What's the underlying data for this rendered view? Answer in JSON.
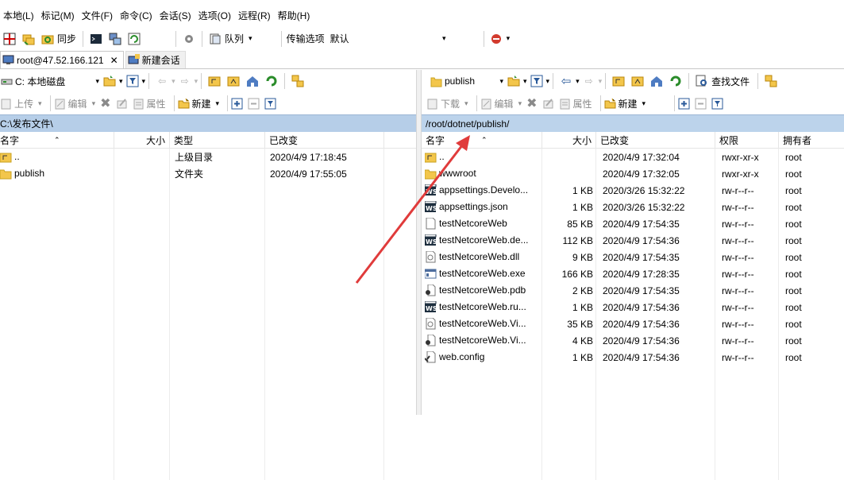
{
  "menu": [
    "本地(L)",
    "标记(M)",
    "文件(F)",
    "命令(C)",
    "会话(S)",
    "选项(O)",
    "远程(R)",
    "帮助(H)"
  ],
  "toolbar": {
    "sync_label": "同步",
    "queue_label": "队列",
    "transfer_options_label": "传输选项",
    "transfer_preset": "默认"
  },
  "tabs": {
    "session": "root@47.52.166.121",
    "new_session": "新建会话"
  },
  "local": {
    "drive": "C: 本地磁盘",
    "actions": {
      "upload": "上传",
      "edit": "编辑",
      "properties": "属性",
      "new": "新建"
    },
    "path": "C:\\发布文件\\",
    "columns": [
      "名字",
      "大小",
      "类型",
      "已改变"
    ],
    "rows": [
      {
        "name": "..",
        "size": "",
        "type": "上级目录",
        "changed": "2020/4/9  17:18:45",
        "icon": "parent-dir-icon"
      },
      {
        "name": "publish",
        "size": "",
        "type": "文件夹",
        "changed": "2020/4/9  17:55:05",
        "icon": "folder-icon"
      }
    ]
  },
  "remote": {
    "folder": "publish",
    "find_files_label": "查找文件",
    "actions": {
      "download": "下载",
      "edit": "编辑",
      "properties": "属性",
      "new": "新建"
    },
    "path": "/root/dotnet/publish/",
    "columns": [
      "名字",
      "大小",
      "已改变",
      "权限",
      "拥有者"
    ],
    "rows": [
      {
        "name": "..",
        "size": "",
        "changed": "2020/4/9 17:32:04",
        "perm": "rwxr-xr-x",
        "owner": "root",
        "icon": "parent-dir-icon"
      },
      {
        "name": "wwwroot",
        "size": "",
        "changed": "2020/4/9 17:32:05",
        "perm": "rwxr-xr-x",
        "owner": "root",
        "icon": "folder-icon"
      },
      {
        "name": "appsettings.Develo...",
        "size": "1 KB",
        "changed": "2020/3/26 15:32:22",
        "perm": "rw-r--r--",
        "owner": "root",
        "icon": "ws-file-icon"
      },
      {
        "name": "appsettings.json",
        "size": "1 KB",
        "changed": "2020/3/26 15:32:22",
        "perm": "rw-r--r--",
        "owner": "root",
        "icon": "ws-file-icon"
      },
      {
        "name": "testNetcoreWeb",
        "size": "85 KB",
        "changed": "2020/4/9 17:54:35",
        "perm": "rw-r--r--",
        "owner": "root",
        "icon": "blank-file-icon"
      },
      {
        "name": "testNetcoreWeb.de...",
        "size": "112 KB",
        "changed": "2020/4/9 17:54:36",
        "perm": "rw-r--r--",
        "owner": "root",
        "icon": "ws-file-icon"
      },
      {
        "name": "testNetcoreWeb.dll",
        "size": "9 KB",
        "changed": "2020/4/9 17:54:35",
        "perm": "rw-r--r--",
        "owner": "root",
        "icon": "dll-file-icon"
      },
      {
        "name": "testNetcoreWeb.exe",
        "size": "166 KB",
        "changed": "2020/4/9 17:28:35",
        "perm": "rw-r--r--",
        "owner": "root",
        "icon": "exe-file-icon"
      },
      {
        "name": "testNetcoreWeb.pdb",
        "size": "2 KB",
        "changed": "2020/4/9 17:54:35",
        "perm": "rw-r--r--",
        "owner": "root",
        "icon": "pdb-file-icon"
      },
      {
        "name": "testNetcoreWeb.ru...",
        "size": "1 KB",
        "changed": "2020/4/9 17:54:36",
        "perm": "rw-r--r--",
        "owner": "root",
        "icon": "ws-file-icon"
      },
      {
        "name": "testNetcoreWeb.Vi...",
        "size": "35 KB",
        "changed": "2020/4/9 17:54:36",
        "perm": "rw-r--r--",
        "owner": "root",
        "icon": "dll-file-icon"
      },
      {
        "name": "testNetcoreWeb.Vi...",
        "size": "4 KB",
        "changed": "2020/4/9 17:54:36",
        "perm": "rw-r--r--",
        "owner": "root",
        "icon": "pdb-file-icon"
      },
      {
        "name": "web.config",
        "size": "1 KB",
        "changed": "2020/4/9 17:54:36",
        "perm": "rw-r--r--",
        "owner": "root",
        "icon": "config-file-icon"
      }
    ]
  },
  "colors": {
    "path_bar": "#b6cee8",
    "annotation_arrow": "#e03b3b",
    "folder": "#f3c64b"
  }
}
